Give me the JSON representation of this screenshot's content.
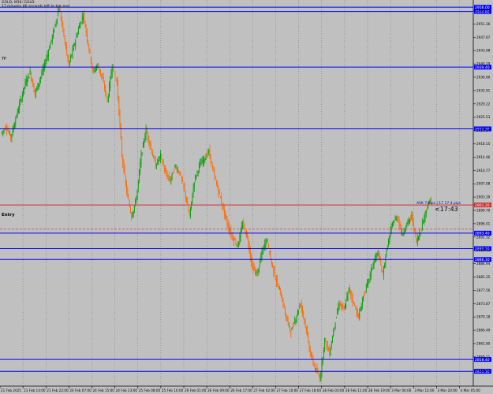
{
  "header": {
    "title": "GOLD, M30: GOLD",
    "timer": "17 minutes 46 seconds left to bar end"
  },
  "tp_label": "TP",
  "entry_label": "Entry",
  "chart_data": {
    "type": "candlestick",
    "symbol": "GOLD",
    "timeframe": "M30",
    "ylim": [
      2851,
      2958
    ],
    "y_ticks": [
      2955.05,
      2951.36,
      2947.67,
      2943.98,
      2940.29,
      2936.6,
      2932.91,
      2929.22,
      2925.53,
      2921.84,
      2918.15,
      2914.46,
      2910.77,
      2907.08,
      2903.39,
      2899.7,
      2896.01,
      2892.32,
      2888.63,
      2884.94,
      2881.25,
      2877.56,
      2873.87,
      2870.18,
      2866.49,
      2862.8,
      2859.11,
      2855.42
    ],
    "x_labels": [
      "21 Feb 2025",
      "21 Feb 14:00",
      "21 Feb 22:00",
      "24 Feb 07:00",
      "24 Feb 15:00",
      "24 Feb 23:00",
      "25 Feb 08:00",
      "25 Feb 16:00",
      "26 Feb 01:00",
      "26 Feb 09:00",
      "26 Feb 17:00",
      "27 Feb 02:00",
      "27 Feb 10:00",
      "27 Feb 18:00",
      "28 Feb 03:00",
      "28 Feb 11:00",
      "28 Feb 19:00",
      "3 Mar 04:00",
      "3 Mar 12:00",
      "3 Mar 20:00",
      "4 Mar 05:00"
    ],
    "bull_color": "#00a000",
    "bear_color": "#ff6a00",
    "hlines": [
      {
        "price": 2956.0,
        "color": "#0000ff",
        "label": "2956.00"
      },
      {
        "price": 2954.8,
        "color": "#0000ff",
        "label": "2954.80"
      },
      {
        "price": 2939.4,
        "color": "#0000ff",
        "label": "2939.40"
      },
      {
        "price": 2922.3,
        "color": "#0000ff",
        "label": "2922.30"
      },
      {
        "price": 2901.2,
        "color": "#cc3030",
        "label": "2901.20"
      },
      {
        "price": 2893.4,
        "color": "#0000ff",
        "label": "2893.40"
      },
      {
        "price": 2889.1,
        "color": "#0000ff",
        "label": "2889.10"
      },
      {
        "price": 2886.1,
        "color": "#0000ff",
        "label": "2886.10"
      },
      {
        "price": 2858.4,
        "color": "#0000ff",
        "label": "2858.40"
      },
      {
        "price": 2855.1,
        "color": "#0000ff",
        "label": "2855.10"
      }
    ],
    "dashed_line": {
      "price": 2894.5,
      "color": "#cc3030"
    },
    "current_price": {
      "price": 2901.2,
      "label": "2901.20"
    },
    "spread_text": "ASK 7 pips | 17 17.4 pips",
    "countdown": "<17:43",
    "path": [
      2921,
      2923,
      2920,
      2925,
      2930,
      2935,
      2938,
      2932,
      2936,
      2940,
      2945,
      2950,
      2956,
      2948,
      2940,
      2945,
      2950,
      2954,
      2946,
      2938,
      2940,
      2936,
      2930,
      2940,
      2935,
      2915,
      2905,
      2898,
      2903,
      2915,
      2922,
      2917,
      2912,
      2915,
      2910,
      2908,
      2912,
      2910,
      2905,
      2898,
      2908,
      2912,
      2914,
      2916,
      2910,
      2905,
      2900,
      2895,
      2892,
      2890,
      2896,
      2892,
      2884,
      2882,
      2888,
      2892,
      2885,
      2880,
      2876,
      2870,
      2866,
      2870,
      2874,
      2868,
      2860,
      2856,
      2853,
      2864,
      2860,
      2868,
      2874,
      2872,
      2878,
      2874,
      2870,
      2876,
      2880,
      2885,
      2888,
      2882,
      2890,
      2896,
      2898,
      2893,
      2896,
      2898,
      2891,
      2895,
      2900,
      2903
    ]
  }
}
